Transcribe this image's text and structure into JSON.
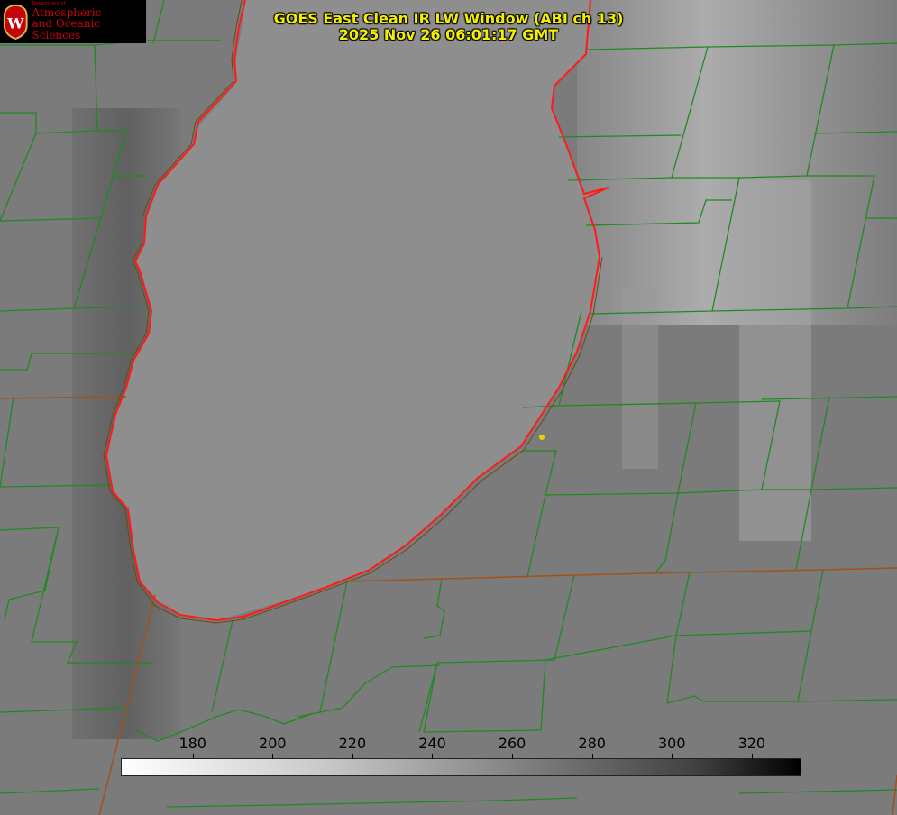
{
  "header": {
    "title_line1": "GOES East Clean IR LW Window (ABI ch 13)",
    "title_line2": "2025 Nov 26 06:01:17 GMT"
  },
  "logo": {
    "dept": "Department of",
    "name_line1": "Atmospheric",
    "name_line2": "and Oceanic Sciences",
    "icon": "uw-crest-icon"
  },
  "colorbar": {
    "ticks": [
      "180",
      "200",
      "220",
      "240",
      "260",
      "280",
      "300",
      "320"
    ],
    "range": [
      162,
      332
    ]
  },
  "colors": {
    "title": "#f2f000",
    "county_lines": "#1f8a1f",
    "shoreline": "#ff1a1a",
    "state_lines": "#a0521a",
    "marker": "#e3d200"
  }
}
